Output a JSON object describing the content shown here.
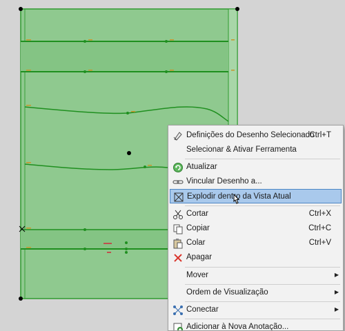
{
  "context_menu": {
    "items": [
      {
        "label": "Definições do Desenho Selecionado",
        "shortcut": "Ctrl+T",
        "icon": "drawing-settings-icon"
      },
      {
        "label": "Selecionar & Ativar Ferramenta",
        "shortcut": "",
        "icon": ""
      },
      {
        "label": "Atualizar",
        "shortcut": "",
        "icon": "refresh-icon"
      },
      {
        "label": "Vincular Desenho a...",
        "shortcut": "",
        "icon": "link-drawing-icon"
      },
      {
        "label": "Explodir dentro da Vista Atual",
        "shortcut": "",
        "icon": "explode-icon",
        "highlighted": true
      },
      {
        "label": "Cortar",
        "shortcut": "Ctrl+X",
        "icon": "scissors-icon"
      },
      {
        "label": "Copiar",
        "shortcut": "Ctrl+C",
        "icon": "copy-icon"
      },
      {
        "label": "Colar",
        "shortcut": "Ctrl+V",
        "icon": "paste-icon"
      },
      {
        "label": "Apagar",
        "shortcut": "",
        "icon": "delete-x-icon"
      },
      {
        "label": "Mover",
        "shortcut": "",
        "icon": "",
        "submenu": true
      },
      {
        "label": "Ordem de Visualização",
        "shortcut": "",
        "icon": "",
        "submenu": true
      },
      {
        "label": "Conectar",
        "shortcut": "",
        "icon": "connect-icon",
        "submenu": true
      },
      {
        "label": "Adicionar à Nova Anotação...",
        "shortcut": "",
        "icon": "add-annotation-icon"
      }
    ]
  },
  "colors": {
    "background": "#d4d4d4",
    "drawing_fill": "#8fc98f",
    "drawing_line": "#2e9a2e",
    "menu_bg": "#f2f2f2",
    "highlight_bg": "#a9c9ec",
    "highlight_border": "#4d86c4",
    "delete_red": "#d9342b"
  }
}
